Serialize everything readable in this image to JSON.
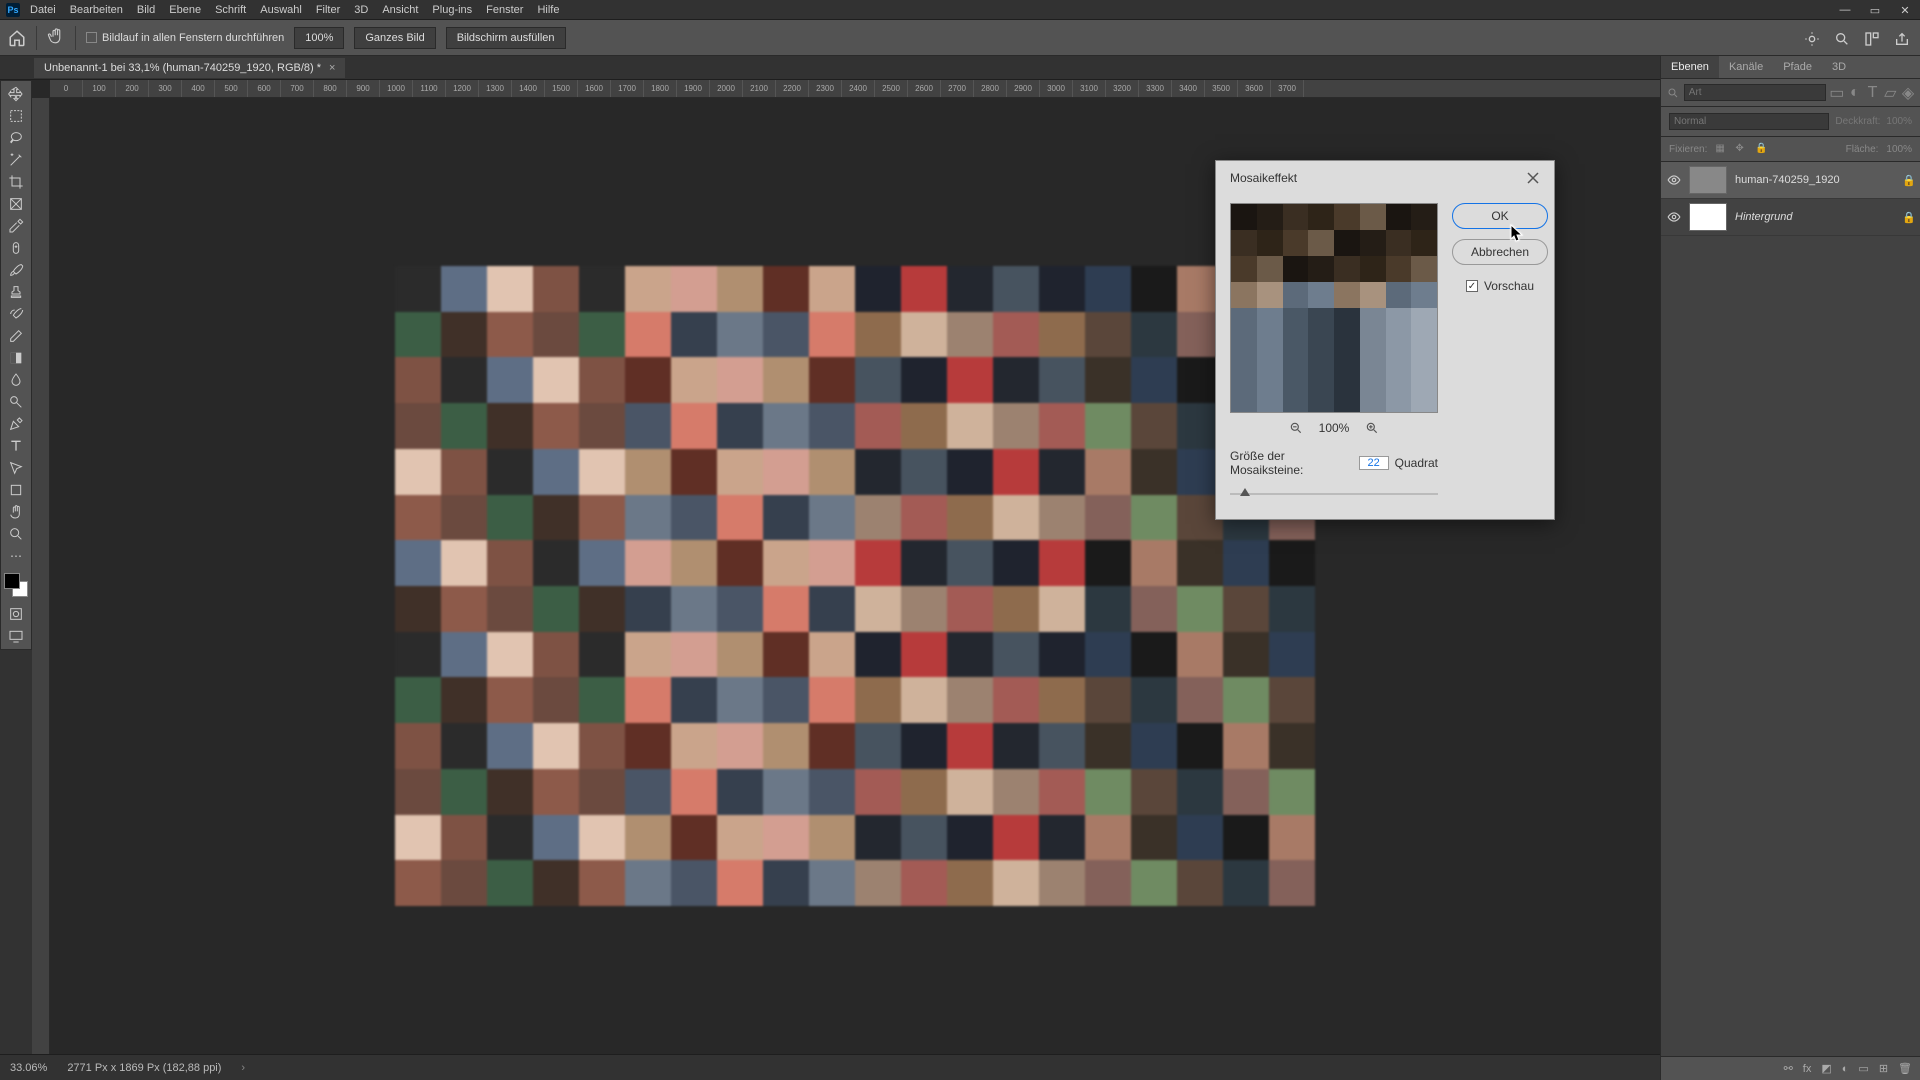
{
  "menu": {
    "items": [
      "Datei",
      "Bearbeiten",
      "Bild",
      "Ebene",
      "Schrift",
      "Auswahl",
      "Filter",
      "3D",
      "Ansicht",
      "Plug-ins",
      "Fenster",
      "Hilfe"
    ]
  },
  "options_bar": {
    "scroll_all_label": "Bildlauf in allen Fenstern durchführen",
    "zoom_value": "100%",
    "fit_label": "Ganzes Bild",
    "fill_label": "Bildschirm ausfüllen"
  },
  "document": {
    "tab_title": "Unbenannt-1 bei 33,1% (human-740259_1920, RGB/8) *"
  },
  "ruler_ticks": [
    "0",
    "100",
    "200",
    "300",
    "400",
    "500",
    "600",
    "700",
    "800",
    "900",
    "1000",
    "1100",
    "1200",
    "1300",
    "1400",
    "1500",
    "1600",
    "1700",
    "1800",
    "1900",
    "2000",
    "2100",
    "2200",
    "2300",
    "2400",
    "2500",
    "2600",
    "2700",
    "2800",
    "2900",
    "3000",
    "3100",
    "3200",
    "3300",
    "3400",
    "3500",
    "3600",
    "3700"
  ],
  "status": {
    "zoom": "33.06%",
    "doc_info": "2771 Px x 1869 Px (182,88 ppi)"
  },
  "panels": {
    "tabs": [
      "Ebenen",
      "Kanäle",
      "Pfade",
      "3D"
    ],
    "search_placeholder": "Art",
    "blend_mode": "Normal",
    "opacity_label": "Deckkraft:",
    "opacity_value": "100%",
    "lock_label": "Fixieren:",
    "fill_label": "Fläche:",
    "fill_value": "100%",
    "layers": [
      {
        "name": "human-740259_1920",
        "locked": true,
        "italic": false,
        "selected": true,
        "thumb": "photo"
      },
      {
        "name": "Hintergrund",
        "locked": true,
        "italic": true,
        "selected": false,
        "thumb": "white"
      }
    ]
  },
  "dialog": {
    "title": "Mosaikeffekt",
    "ok": "OK",
    "cancel": "Abbrechen",
    "preview_label": "Vorschau",
    "preview_checked": true,
    "zoom_value": "100%",
    "param_label": "Größe der Mosaiksteine:",
    "param_value": "22",
    "param_unit": "Quadrat"
  }
}
